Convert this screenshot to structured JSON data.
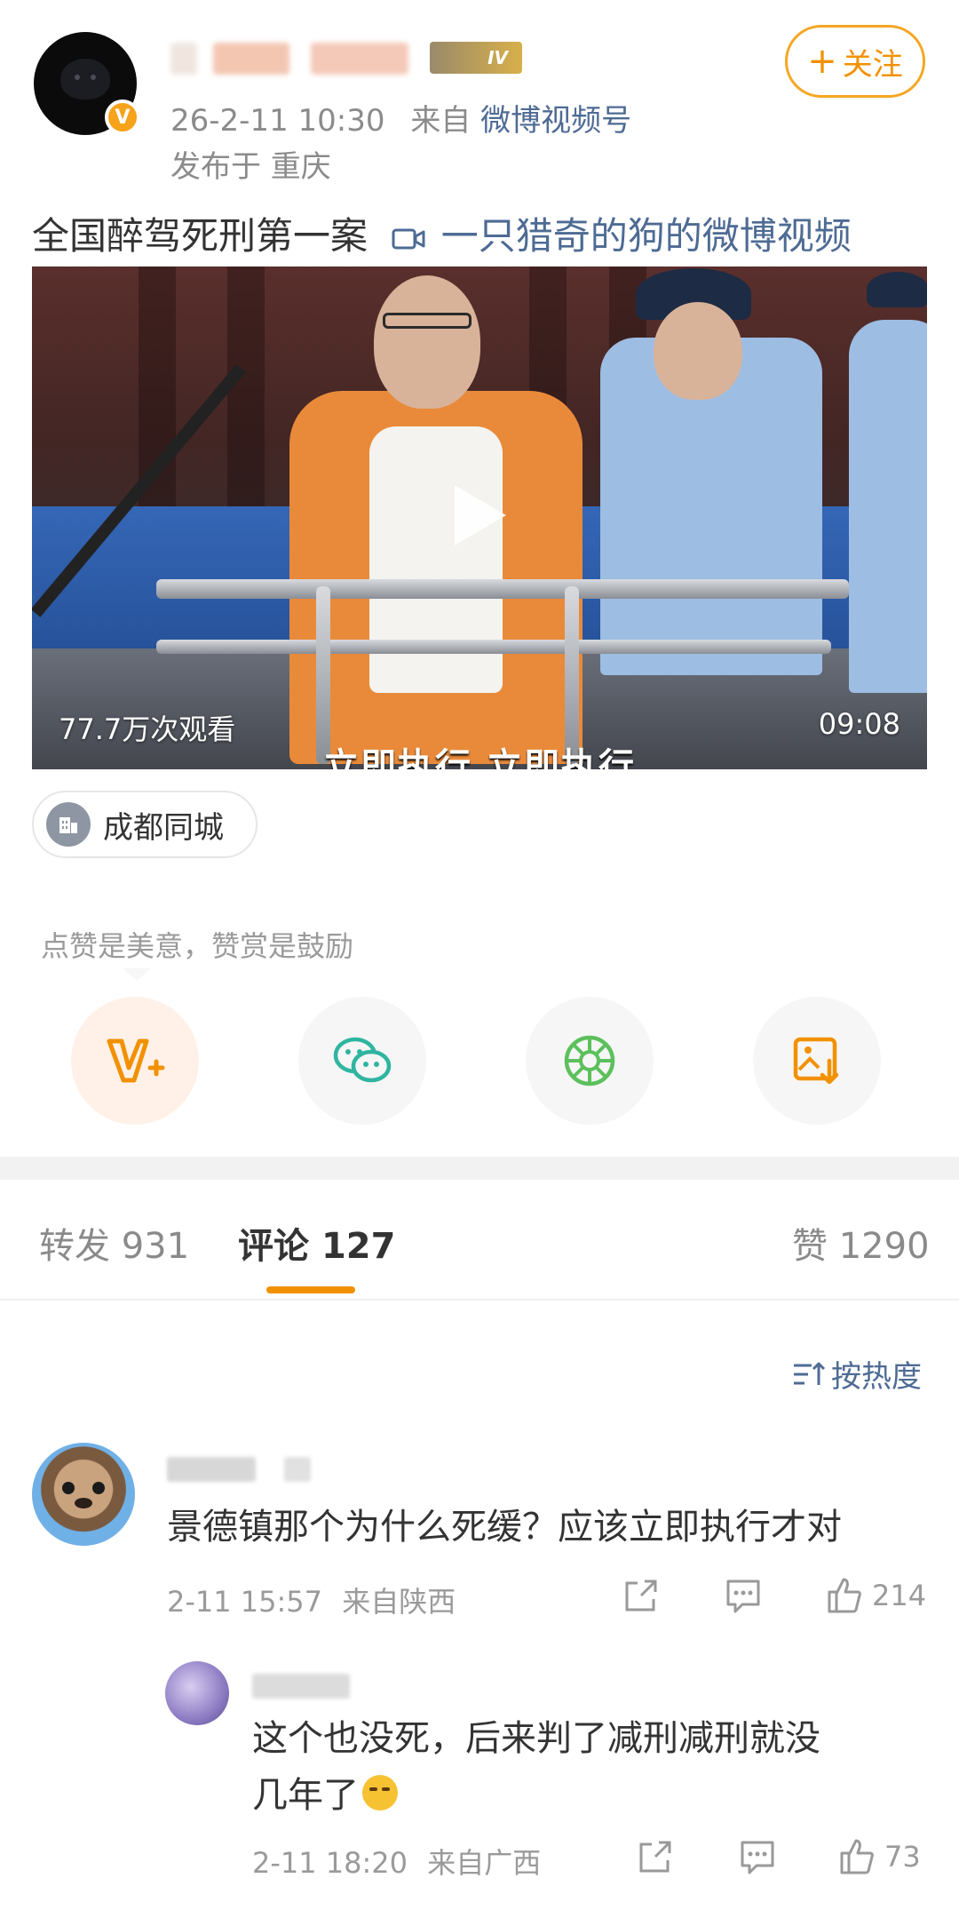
{
  "post": {
    "date": "26-2-11 10:30",
    "source_prefix": "来自",
    "source": "微博视频号",
    "published_location": "发布于 重庆",
    "level_badge": "IV",
    "follow_label": "关注",
    "title": "全国醉驾死刑第一案",
    "title_link": "一只猎奇的狗的微博视频"
  },
  "video": {
    "views": "77.7万次观看",
    "duration": "09:08",
    "subtitle": "立即执行 立即执行"
  },
  "location_chip": {
    "label": "成都同城"
  },
  "reward_tip": "点赞是美意，赞赏是鼓励",
  "share_icons": [
    "reward-v-plus-icon",
    "wechat-icon",
    "moments-icon",
    "save-image-icon"
  ],
  "tabs": [
    {
      "label": "转发",
      "count": "931"
    },
    {
      "label": "评论",
      "count": "127"
    },
    {
      "label": "赞",
      "count": "1290"
    }
  ],
  "sort_label": "按热度",
  "comments": [
    {
      "text": "景德镇那个为什么死缓？应该立即执行才对",
      "time": "2-11 15:57",
      "location": "来自陕西",
      "likes": "214"
    },
    {
      "text_line1": "这个也没死，后来判了减刑减刑就没",
      "text_line2": "几年了",
      "time": "2-11 18:20",
      "location": "来自广西",
      "likes": "73"
    }
  ],
  "colors": {
    "accent": "#f29100",
    "link": "#4e6b94",
    "muted": "#9a9a9a"
  }
}
